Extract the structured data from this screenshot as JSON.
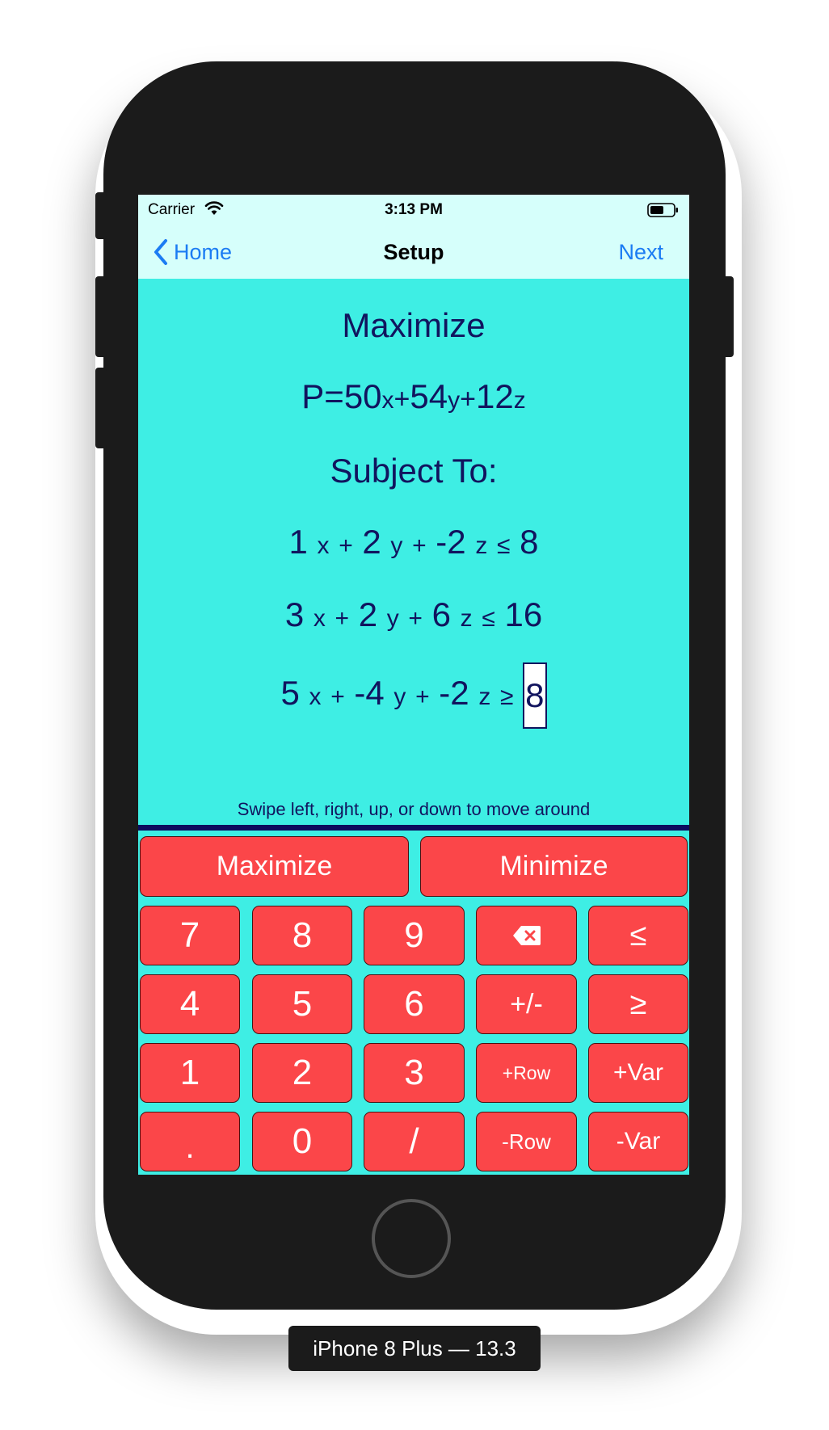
{
  "device": {
    "label": "iPhone 8 Plus — 13.3"
  },
  "status_bar": {
    "carrier": "Carrier",
    "time": "3:13 PM"
  },
  "nav": {
    "back_label": "Home",
    "title": "Setup",
    "next_label": "Next"
  },
  "problem": {
    "heading": "Maximize",
    "objective": {
      "lhs": "P",
      "eq": "=",
      "c1": "50",
      "v1": "x",
      "op1": "+",
      "c2": "54",
      "v2": "y",
      "op2": "+",
      "c3": "12",
      "v3": "z"
    },
    "subject_label": "Subject To:",
    "constraints": [
      {
        "c1": "1",
        "v1": "x",
        "op1": "+",
        "c2": "2",
        "v2": "y",
        "op2": "+",
        "c3": "-2",
        "v3": "z",
        "rel": "≤",
        "rhs": "8"
      },
      {
        "c1": "3",
        "v1": "x",
        "op1": "+",
        "c2": "2",
        "v2": "y",
        "op2": "+",
        "c3": "6",
        "v3": "z",
        "rel": "≤",
        "rhs": "16"
      },
      {
        "c1": "5",
        "v1": "x",
        "op1": "+",
        "c2": "-4",
        "v2": "y",
        "op2": "+",
        "c3": "-2",
        "v3": "z",
        "rel": "≥",
        "rhs": "8"
      }
    ],
    "hint": "Swipe left, right, up, or down to move around"
  },
  "keypad": {
    "maximize": "Maximize",
    "minimize": "Minimize",
    "rows": [
      [
        "7",
        "8",
        "9",
        "",
        "≤"
      ],
      [
        "4",
        "5",
        "6",
        "+/-",
        "≥"
      ],
      [
        "1",
        "2",
        "3",
        "+Row",
        "+Var"
      ],
      [
        ".",
        "0",
        "/",
        "-Row",
        "-Var"
      ]
    ]
  },
  "colors": {
    "screen_bg": "#3eeee4",
    "nav_bg": "#d6fffb",
    "key_bg": "#fb4649",
    "text": "#11145e",
    "link": "#1b7cf3"
  }
}
